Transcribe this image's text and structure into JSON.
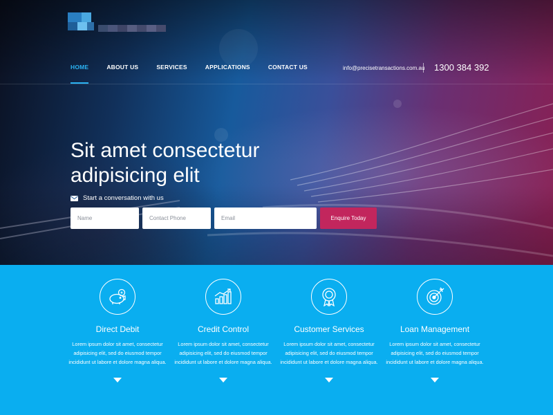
{
  "nav": {
    "items": [
      {
        "label": "HOME",
        "active": true
      },
      {
        "label": "ABOUT US",
        "active": false
      },
      {
        "label": "SERVICES",
        "active": false
      },
      {
        "label": "APPLICATIONS",
        "active": false
      },
      {
        "label": "CONTACT US",
        "active": false
      }
    ]
  },
  "contact": {
    "email": "info@precisetransactions.com.au",
    "phone": "1300 384 392"
  },
  "hero": {
    "title": "Sit amet consectetur adipisicing elit",
    "conversation_label": "Start a conversation with us",
    "fields": {
      "name_placeholder": "Name",
      "phone_placeholder": "Contact Phone",
      "email_placeholder": "Email"
    },
    "cta_label": "Enquire Today"
  },
  "services": [
    {
      "icon": "piggy-bank-icon",
      "title": "Direct Debit",
      "text": "Lorem ipsum dolor sit amet, consectetur adipisicing elit, sed do eiusmod tempor incididunt ut labore et dolore magna aliqua."
    },
    {
      "icon": "bar-chart-icon",
      "title": "Credit Control",
      "text": "Lorem ipsum dolor sit amet, consectetur adipisicing elit, sed do eiusmod tempor incididunt ut labore et dolore magna aliqua."
    },
    {
      "icon": "award-badge-icon",
      "title": "Customer Services",
      "text": "Lorem ipsum dolor sit amet, consectetur adipisicing elit, sed do eiusmod tempor incididunt ut labore et dolore magna aliqua."
    },
    {
      "icon": "target-icon",
      "title": "Loan Management",
      "text": "Lorem ipsum dolor sit amet, consectetur adipisicing elit, sed do eiusmod tempor incididunt ut labore et dolore magna aliqua."
    }
  ],
  "colors": {
    "accent_blue": "#2bb3f3",
    "cta_pink": "#c2265d",
    "services_bg": "#0aaef0"
  }
}
